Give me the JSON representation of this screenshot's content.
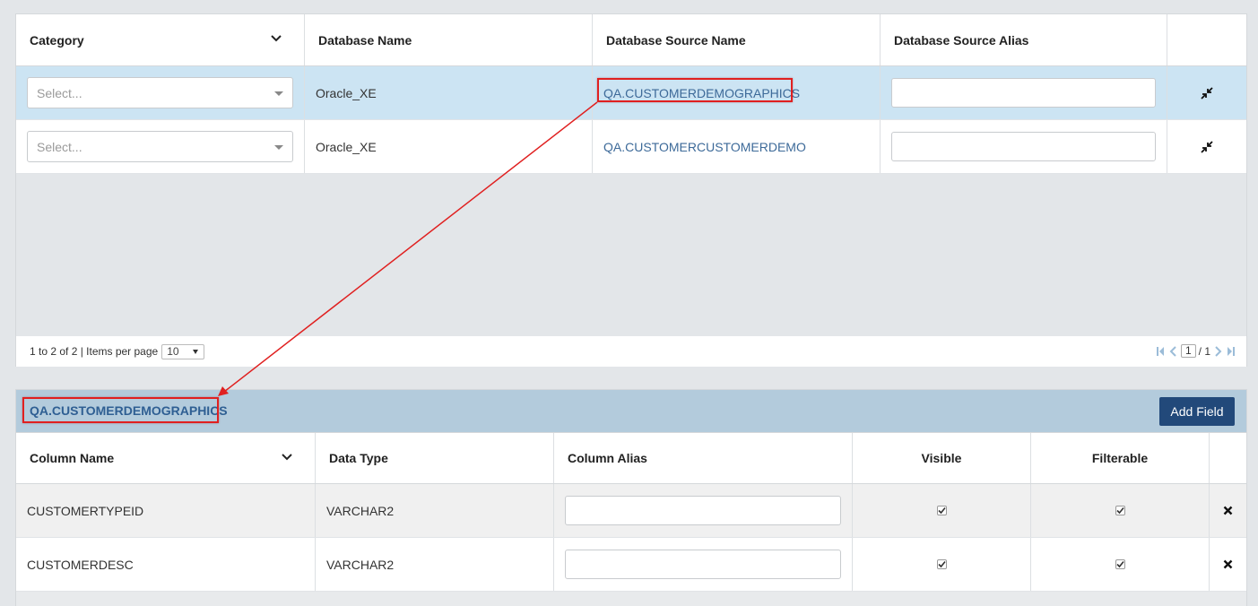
{
  "top_grid": {
    "headers": {
      "category": "Category",
      "database_name": "Database Name",
      "database_source_name": "Database Source Name",
      "database_source_alias": "Database Source Alias"
    },
    "rows": [
      {
        "category_placeholder": "Select...",
        "database_name": "Oracle_XE",
        "database_source_name": "QA.CUSTOMERDEMOGRAPHICS",
        "alias": ""
      },
      {
        "category_placeholder": "Select...",
        "database_name": "Oracle_XE",
        "database_source_name": "QA.CUSTOMERCUSTOMERDEMO",
        "alias": ""
      }
    ],
    "footer": {
      "range_text": "1 to 2 of 2 | Items per page",
      "items_per_page": "10",
      "current_page": "1",
      "total_pages_text": "/ 1"
    }
  },
  "bottom_grid": {
    "title": "QA.CUSTOMERDEMOGRAPHICS",
    "add_field_label": "Add Field",
    "headers": {
      "column_name": "Column Name",
      "data_type": "Data Type",
      "column_alias": "Column Alias",
      "visible": "Visible",
      "filterable": "Filterable"
    },
    "rows": [
      {
        "column_name": "CUSTOMERTYPEID",
        "data_type": "VARCHAR2",
        "alias": "",
        "visible": true,
        "filterable": true
      },
      {
        "column_name": "CUSTOMERDESC",
        "data_type": "VARCHAR2",
        "alias": "",
        "visible": true,
        "filterable": true
      }
    ]
  },
  "colors": {
    "selected_row": "#cce4f3",
    "link": "#3d6a99",
    "title_bar": "#b3cbdc",
    "primary_button": "#22497a",
    "annotation": "#e02020"
  },
  "icons": {
    "sort_chevron": "chevron-down-icon",
    "row_action": "compress-icon",
    "remove": "close-icon",
    "pager": [
      "first-page-icon",
      "prev-page-icon",
      "next-page-icon",
      "last-page-icon"
    ]
  }
}
